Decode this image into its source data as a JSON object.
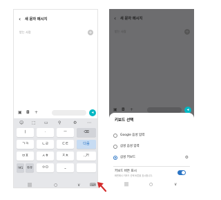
{
  "screens": {
    "left": {
      "header": {
        "back_icon": "‹",
        "title": "새 문자 메시지"
      },
      "recipient": {
        "placeholder": "받는 사람",
        "add_icon": "+"
      },
      "composer": {
        "icons": [
          "▣",
          "◘",
          "+"
        ],
        "send_icon": "◂"
      },
      "keyboard": {
        "toolbar": [
          "☺",
          "⬚",
          "▭",
          "⚲",
          "⚙",
          "⋯"
        ],
        "rows": [
          [
            {
              "label": "ㅣ",
              "type": "normal"
            },
            {
              "label": "ㆍ",
              "type": "normal"
            },
            {
              "label": "ㅡ",
              "type": "normal"
            },
            {
              "label": "⌫",
              "type": "gray"
            }
          ],
          [
            {
              "label": "ㄱㅋ",
              "type": "normal"
            },
            {
              "label": "ㄴㄹ",
              "type": "normal"
            },
            {
              "label": "ㄷㅌ",
              "type": "normal"
            },
            {
              "label": "다음",
              "type": "blue"
            }
          ],
          [
            {
              "label": "ㅂㅍ",
              "type": "normal"
            },
            {
              "label": "ㅅㅎ",
              "type": "normal"
            },
            {
              "label": "ㅈㅊ",
              "type": "normal"
            },
            {
              "label": ".,?!",
              "type": "normal"
            }
          ],
          [
            {
              "label": "!#1",
              "type": "gray"
            },
            {
              "label": "한/영",
              "type": "gray"
            },
            {
              "label": "ㅇㅁ",
              "type": "normal"
            },
            {
              "label": "⎵",
              "type": "normal"
            },
            {
              "label": "",
              "type": "normal"
            }
          ]
        ],
        "nav": [
          "|||",
          "○",
          "∨",
          "⌨"
        ]
      }
    },
    "right": {
      "header": {
        "back_icon": "‹",
        "title": "새 문자 메시지"
      },
      "recipient": {
        "placeholder": "받는 사람",
        "add_icon": "+"
      },
      "composer": {
        "icons": [
          "▣",
          "◘",
          "+"
        ],
        "send_icon": "◂"
      },
      "sheet": {
        "title": "키보드 선택",
        "options": [
          {
            "label": "Google 음성 입력",
            "selected": false
          },
          {
            "label": "삼성 음성 입력",
            "selected": false
          },
          {
            "label": "삼성 키보드",
            "selected": true,
            "settings_icon": "⚙"
          }
        ],
        "toggle": {
          "label": "키보드 버튼 표시",
          "description": "화면에서 키보드 선택 버튼을 표시합니다.",
          "on": true
        }
      },
      "nav": [
        "|||",
        "○",
        "∨"
      ]
    }
  },
  "colors": {
    "accent": "#2a74c4",
    "send": "#00b7c3",
    "annotation_arrow": "#d32b2b"
  }
}
